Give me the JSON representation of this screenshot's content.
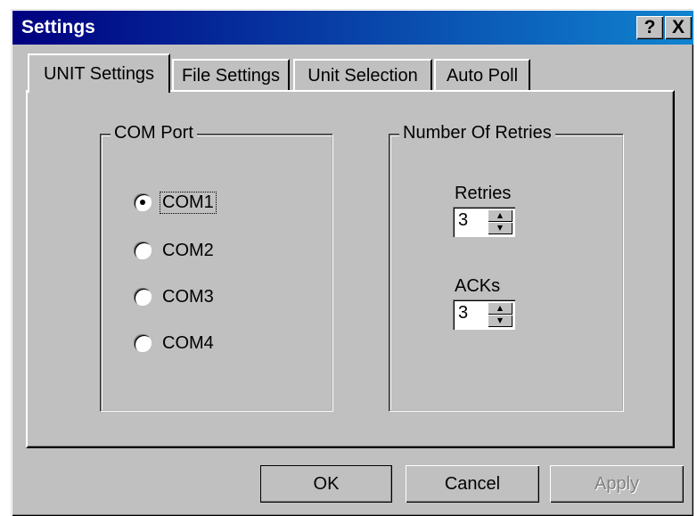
{
  "window": {
    "title": "Settings",
    "help_glyph": "?",
    "close_glyph": "X"
  },
  "tabs": [
    {
      "label": "UNIT Settings",
      "active": true
    },
    {
      "label": "File Settings",
      "active": false
    },
    {
      "label": "Unit Selection",
      "active": false
    },
    {
      "label": "Auto Poll",
      "active": false
    }
  ],
  "com_port": {
    "label": "COM Port",
    "options": [
      {
        "label": "COM1",
        "checked": true
      },
      {
        "label": "COM2",
        "checked": false
      },
      {
        "label": "COM3",
        "checked": false
      },
      {
        "label": "COM4",
        "checked": false
      }
    ]
  },
  "retries_group": {
    "label": "Number Of Retries",
    "retries": {
      "label": "Retries",
      "value": "3"
    },
    "acks": {
      "label": "ACKs",
      "value": "3"
    }
  },
  "buttons": {
    "ok": "OK",
    "cancel": "Cancel",
    "apply": "Apply"
  },
  "icons": {
    "help": "help-question-icon",
    "close": "close-x-icon",
    "spin_up": "triangle-up-icon",
    "spin_down": "triangle-down-icon"
  }
}
